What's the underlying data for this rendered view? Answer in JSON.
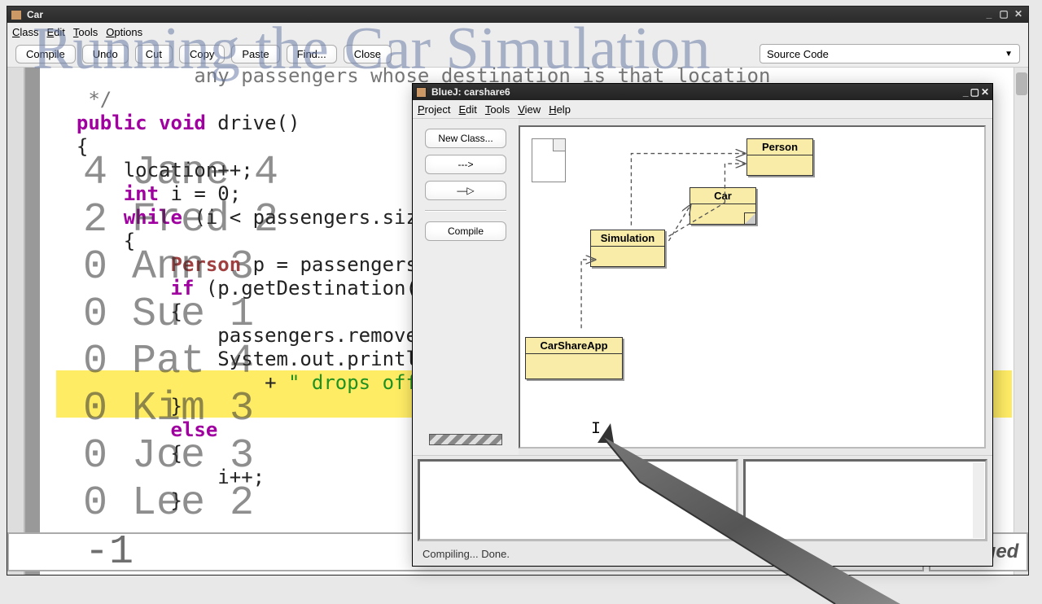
{
  "overlay": {
    "title": "Running the Car Simulation",
    "passengers": [
      "4 Jane 4",
      "2 Fred 2",
      "0 Ann 3",
      "0 Sue 1",
      "0 Pat 4",
      "0 Kim 3",
      "0 Joe 3",
      "0 Lee 2"
    ],
    "sentinel": "-1"
  },
  "editor": {
    "title": "Car",
    "menu": {
      "class": "Class",
      "edit": "Edit",
      "tools": "Tools",
      "options": "Options"
    },
    "toolbar": {
      "compile": "Compile",
      "undo": "Undo",
      "cut": "Cut",
      "copy": "Copy",
      "paste": "Paste",
      "find": "Find...",
      "close": "Close"
    },
    "view_selector": "Source Code",
    "status_changed": "changed",
    "code_lines": [
      "            any passengers whose destination is that location",
      "   */",
      "  public void drive()",
      "  {",
      "      location++;",
      "      int i = 0;",
      "      while (i < passengers.size())",
      "      {",
      "          Person p = passengers.get(i);",
      "          if (p.getDestination() == location)",
      "          {",
      "              passengers.remove(i);",
      "              System.out.println(driverName",
      "                  + \" drops off \" + p.getName());",
      "          }",
      "          else",
      "          {",
      "              i++;",
      "          }"
    ]
  },
  "bluej": {
    "title": "BlueJ:  carshare6",
    "menu": {
      "project": "Project",
      "edit": "Edit",
      "tools": "Tools",
      "view": "View",
      "help": "Help"
    },
    "side": {
      "new_class": "New Class...",
      "uses_arrow": "--->",
      "inherit_arrow": "—▷",
      "compile": "Compile"
    },
    "classes": {
      "person": "Person",
      "car": "Car",
      "simulation": "Simulation",
      "carshareapp": "CarShareApp"
    },
    "compile_status": "Compiling... Done."
  }
}
